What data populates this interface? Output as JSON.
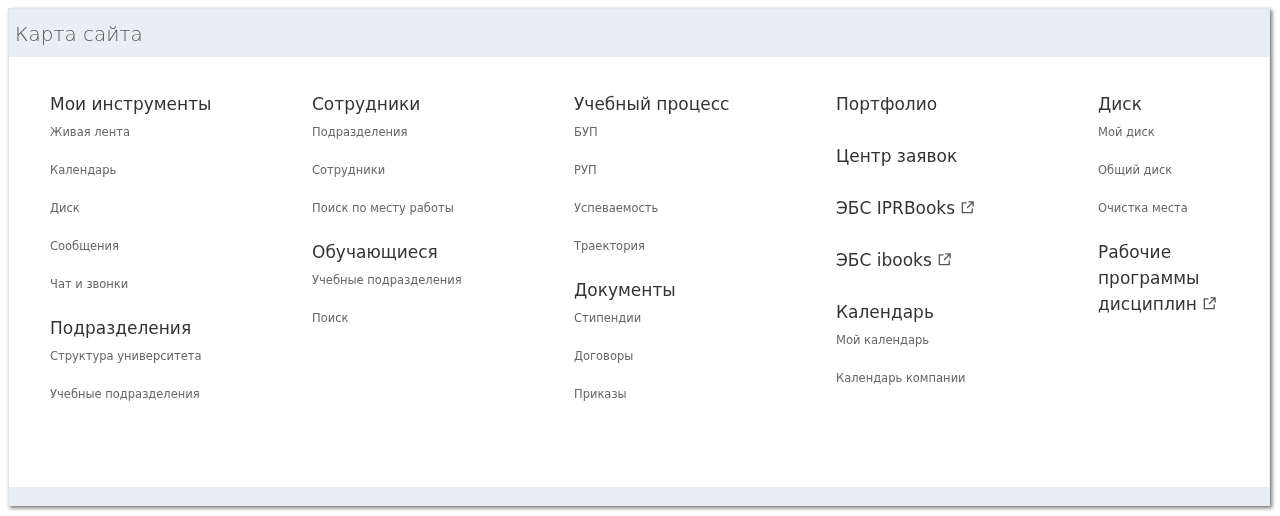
{
  "header": {
    "title": "Карта сайта"
  },
  "columns": [
    {
      "sections": [
        {
          "title": "Мои инструменты",
          "external": false,
          "links": [
            "Живая лента",
            "Календарь",
            "Диск",
            "Сообщения",
            "Чат и звонки"
          ]
        },
        {
          "title": "Подразделения",
          "external": false,
          "links": [
            "Структура университета",
            "Учебные подразделения"
          ]
        }
      ]
    },
    {
      "sections": [
        {
          "title": "Сотрудники",
          "external": false,
          "links": [
            "Подразделения",
            "Сотрудники",
            "Поиск по месту работы"
          ]
        },
        {
          "title": "Обучающиеся",
          "external": false,
          "links": [
            "Учебные подразделения",
            "Поиск"
          ]
        }
      ]
    },
    {
      "sections": [
        {
          "title": "Учебный процесс",
          "external": false,
          "links": [
            "БУП",
            "РУП",
            "Успеваемость",
            "Траектория"
          ]
        },
        {
          "title": "Документы",
          "external": false,
          "links": [
            "Стипендии",
            "Договоры",
            "Приказы"
          ]
        }
      ]
    },
    {
      "sections": [
        {
          "title": "Портфолио",
          "external": false
        },
        {
          "title": "Центр заявок",
          "external": false
        },
        {
          "title": "ЭБС IPRBooks",
          "external": true
        },
        {
          "title": "ЭБС ibooks",
          "external": true
        },
        {
          "title": "Календарь",
          "external": false,
          "links": [
            "Мой календарь",
            "Календарь компании"
          ]
        }
      ]
    },
    {
      "sections": [
        {
          "title": "Диск",
          "external": false,
          "links": [
            "Мой диск",
            "Общий диск",
            "Очистка места"
          ]
        },
        {
          "title": "Рабочие программы дисциплин",
          "external": true
        }
      ]
    }
  ]
}
